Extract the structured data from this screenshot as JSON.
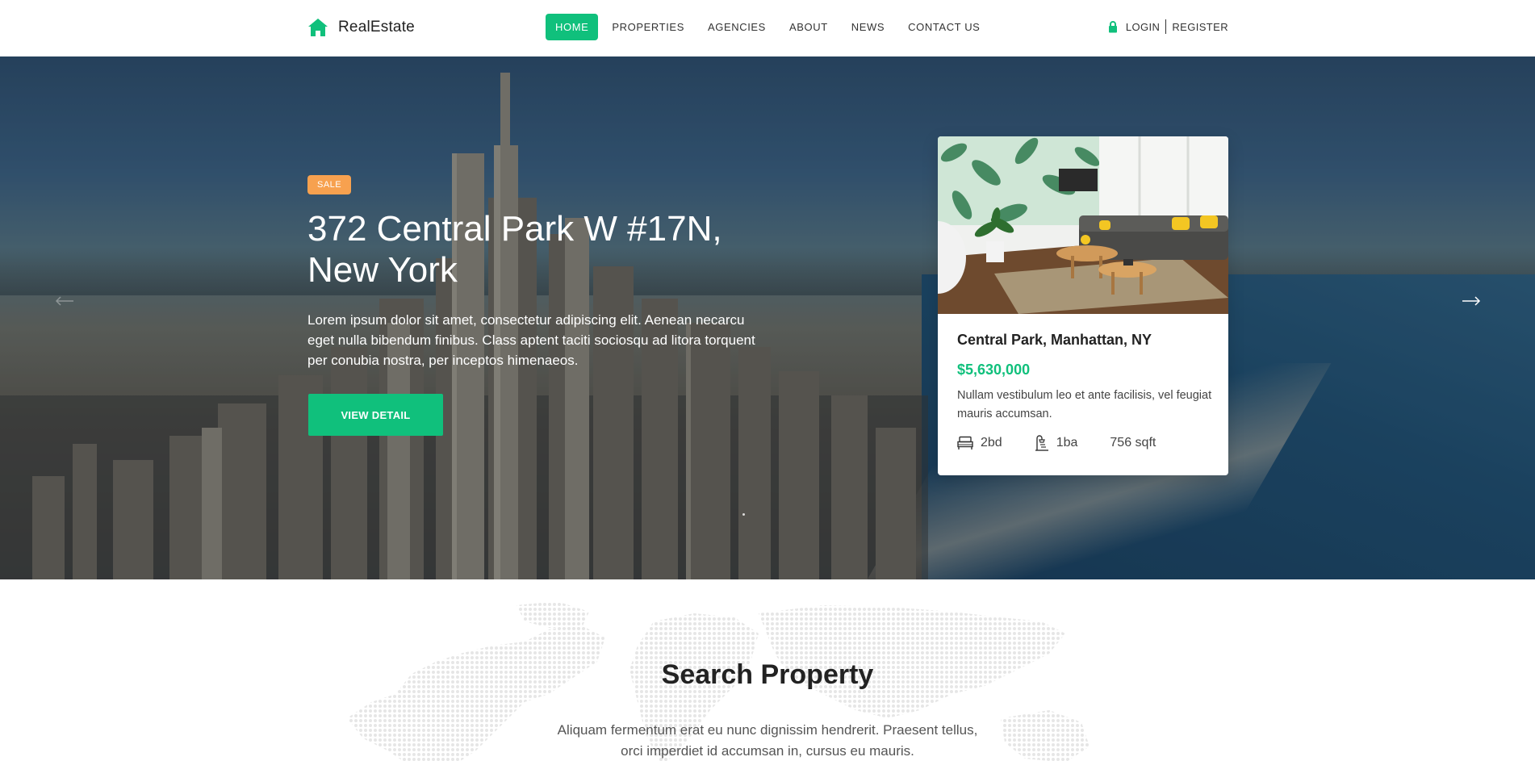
{
  "brand": {
    "name": "RealEstate",
    "icon": "home-icon",
    "accent_color": "#10c07c"
  },
  "nav": {
    "items": [
      {
        "label": "HOME",
        "active": true
      },
      {
        "label": "PROPERTIES",
        "active": false
      },
      {
        "label": "AGENCIES",
        "active": false
      },
      {
        "label": "ABOUT",
        "active": false
      },
      {
        "label": "NEWS",
        "active": false
      },
      {
        "label": "CONTACT US",
        "active": false
      }
    ],
    "login_label": "LOGIN",
    "register_label": "REGISTER",
    "login_icon": "lock-icon"
  },
  "hero": {
    "badge": "SALE",
    "badge_color": "#f7a14f",
    "title": "372 Central Park W #17N, New York",
    "description": "Lorem ipsum dolor sit amet, consectetur adipiscing elit. Aenean necarcu eget nulla bibendum finibus. Class aptent taciti sociosqu ad litora torquent per conubia nostra, per inceptos himenaeos.",
    "cta_label": "VIEW DETAIL",
    "prev_icon": "arrow-left-icon",
    "next_icon": "arrow-right-icon"
  },
  "card": {
    "location": "Central Park, Manhattan, NY",
    "price": "$5,630,000",
    "description": "Nullam vestibulum leo et ante facilisis, vel feugiat mauris accumsan.",
    "beds": "2bd",
    "baths": "1ba",
    "area": "756 sqft",
    "bed_icon": "bed-icon",
    "bath_icon": "bath-icon"
  },
  "search": {
    "title": "Search Property",
    "description": "Aliquam fermentum erat eu nunc dignissim hendrerit. Praesent tellus, orci imperdiet id accumsan in, cursus eu mauris."
  }
}
